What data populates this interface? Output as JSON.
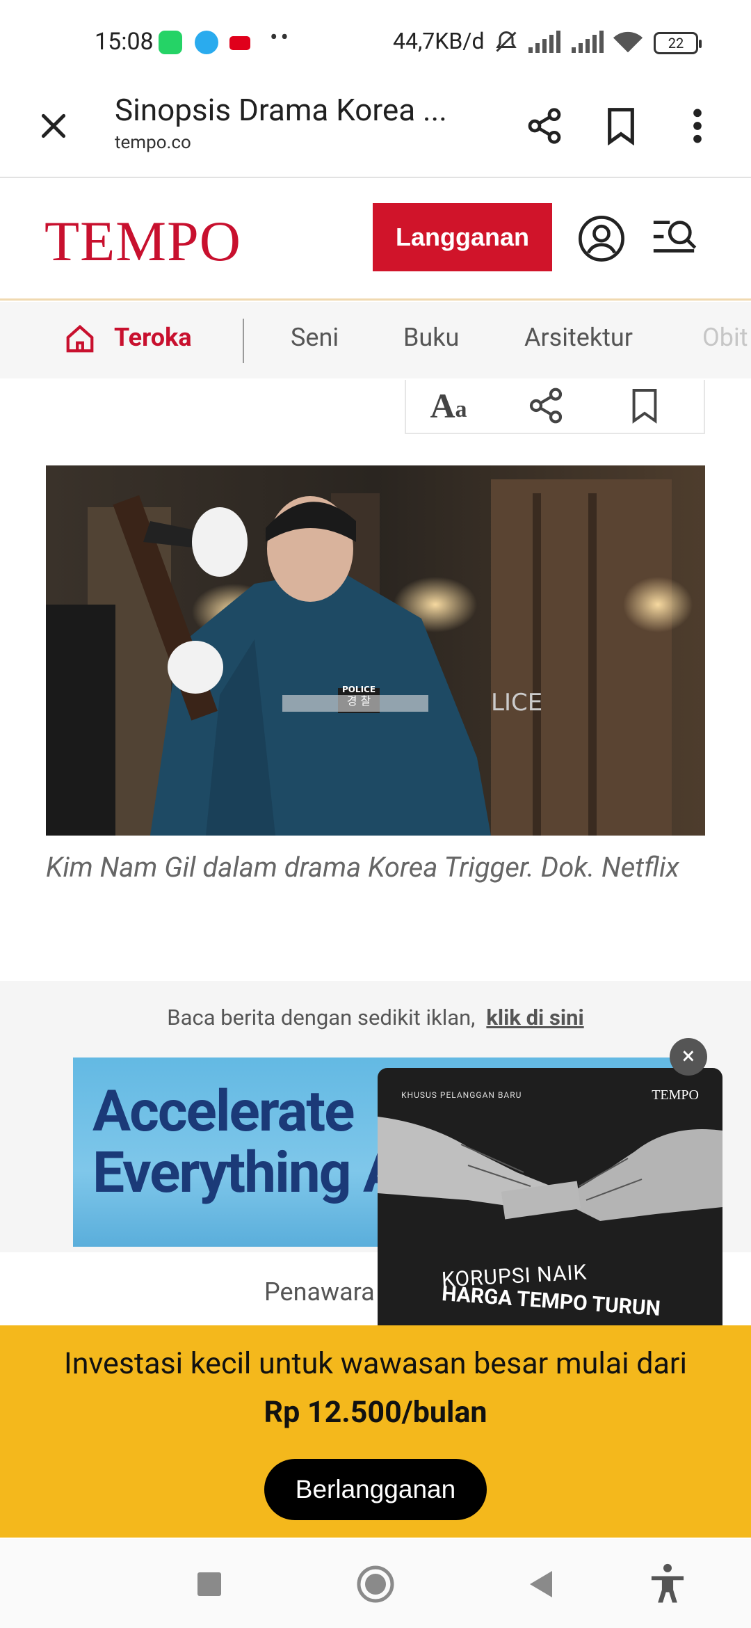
{
  "status_bar": {
    "time": "15:08",
    "network_speed": "44,7KB/d",
    "battery": "22"
  },
  "browser": {
    "page_title": "Sinopsis Drama Korea ...",
    "domain": "tempo.co"
  },
  "site": {
    "logo": "TEMPO",
    "subscribe_label": "Langganan",
    "brand_color": "#c8102e"
  },
  "categories": {
    "items": [
      "Teroka",
      "Seni",
      "Buku",
      "Arsitektur",
      "Obit"
    ],
    "active": "Teroka"
  },
  "article_tools": {
    "font_label_big": "A",
    "font_label_small": "a"
  },
  "article": {
    "caption": "Kim Nam Gil dalam drama Korea Trigger. Dok. Netflix",
    "photo_patch_top": "경 찰",
    "photo_patch_bottom": "POLICE",
    "photo_vest_text": "LICE"
  },
  "ads": {
    "notice": "Baca berita dengan sedikit iklan,",
    "notice_link": "klik di sini",
    "banner_line1": "Accelerate",
    "banner_line2": "Everything A",
    "offer_text": "Penawara"
  },
  "popup": {
    "small_label": "KHUSUS PELANGGAN BARU",
    "logo": "TEMPO",
    "line1": "KORUPSI NAIK",
    "line2": "HARGA TEMPO TURUN",
    "close_label": "×"
  },
  "promo_banner": {
    "line1": "Investasi kecil untuk wawasan besar mulai dari",
    "line2": "Rp 12.500/bulan",
    "cta": "Berlangganan"
  }
}
